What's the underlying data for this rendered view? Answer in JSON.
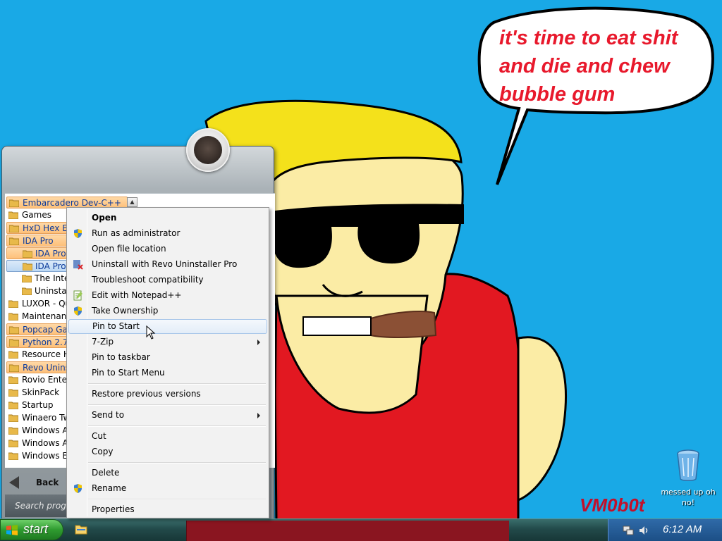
{
  "wallpaper": {
    "speech_lines": [
      "it's time to eat shit",
      "and die and chew",
      "bubble gum"
    ],
    "signature": "VM0b0t"
  },
  "desktop_icons": [
    {
      "name": "recycle-bin-icon",
      "label_lines": [
        "messed up oh",
        "no!"
      ]
    }
  ],
  "start_menu": {
    "programs": [
      {
        "label": "Embarcadero Dev-C++",
        "style": "hl"
      },
      {
        "label": "Games",
        "style": ""
      },
      {
        "label": "HxD Hex Editor",
        "style": "hl"
      },
      {
        "label": "IDA Pro",
        "style": "hl"
      },
      {
        "label": "IDA Pro",
        "style": "sub-hl"
      },
      {
        "label": "IDA Pro",
        "style": "sub-sel"
      },
      {
        "label": "The Interactive Disassembler",
        "style": "sub"
      },
      {
        "label": "Uninstall",
        "style": "sub"
      },
      {
        "label": "LUXOR - Quest",
        "style": ""
      },
      {
        "label": "Maintenance",
        "style": ""
      },
      {
        "label": "Popcap Games",
        "style": "hl"
      },
      {
        "label": "Python 2.7",
        "style": "hl"
      },
      {
        "label": "Resource Hacker",
        "style": ""
      },
      {
        "label": "Revo Uninstaller",
        "style": "hl"
      },
      {
        "label": "Rovio Entertainment",
        "style": ""
      },
      {
        "label": "SkinPack",
        "style": ""
      },
      {
        "label": "Startup",
        "style": ""
      },
      {
        "label": "Winaero Tweaker",
        "style": ""
      },
      {
        "label": "Windows Accessories",
        "style": ""
      },
      {
        "label": "Windows Administrative Tools",
        "style": ""
      },
      {
        "label": "Windows Ease of Access",
        "style": ""
      }
    ],
    "back_label": "Back",
    "search_placeholder": "Search programs and files"
  },
  "context_menu": {
    "items": [
      {
        "label": "Open",
        "icon": "",
        "bold": true
      },
      {
        "label": "Run as administrator",
        "icon": "shield-icon"
      },
      {
        "label": "Open file location",
        "icon": ""
      },
      {
        "label": "Uninstall with Revo Uninstaller Pro",
        "icon": "revo-uninstaller-icon"
      },
      {
        "label": "Troubleshoot compatibility",
        "icon": ""
      },
      {
        "label": "Edit with Notepad++",
        "icon": "notepad-plus-plus-icon"
      },
      {
        "label": "Take Ownership",
        "icon": "shield-icon"
      },
      {
        "label": "Pin to Start",
        "icon": "",
        "hover": true
      },
      {
        "label": "7-Zip",
        "icon": "",
        "submenu": true
      },
      {
        "label": "Pin to taskbar",
        "icon": ""
      },
      {
        "label": "Pin to Start Menu",
        "icon": ""
      },
      {
        "separator": true
      },
      {
        "label": "Restore previous versions",
        "icon": ""
      },
      {
        "separator": true
      },
      {
        "label": "Send to",
        "icon": "",
        "submenu": true
      },
      {
        "separator": true
      },
      {
        "label": "Cut",
        "icon": ""
      },
      {
        "label": "Copy",
        "icon": ""
      },
      {
        "separator": true
      },
      {
        "label": "Delete",
        "icon": ""
      },
      {
        "label": "Rename",
        "icon": "shield-icon"
      },
      {
        "separator": true
      },
      {
        "label": "Properties",
        "icon": ""
      }
    ]
  },
  "taskbar": {
    "start_label": "start",
    "clock": "6:12 AM"
  },
  "colors": {
    "desktop": "#19a9e6",
    "speech_text": "#e8192c",
    "start_button": "#2f9b30",
    "tray": "#1c4f86"
  }
}
